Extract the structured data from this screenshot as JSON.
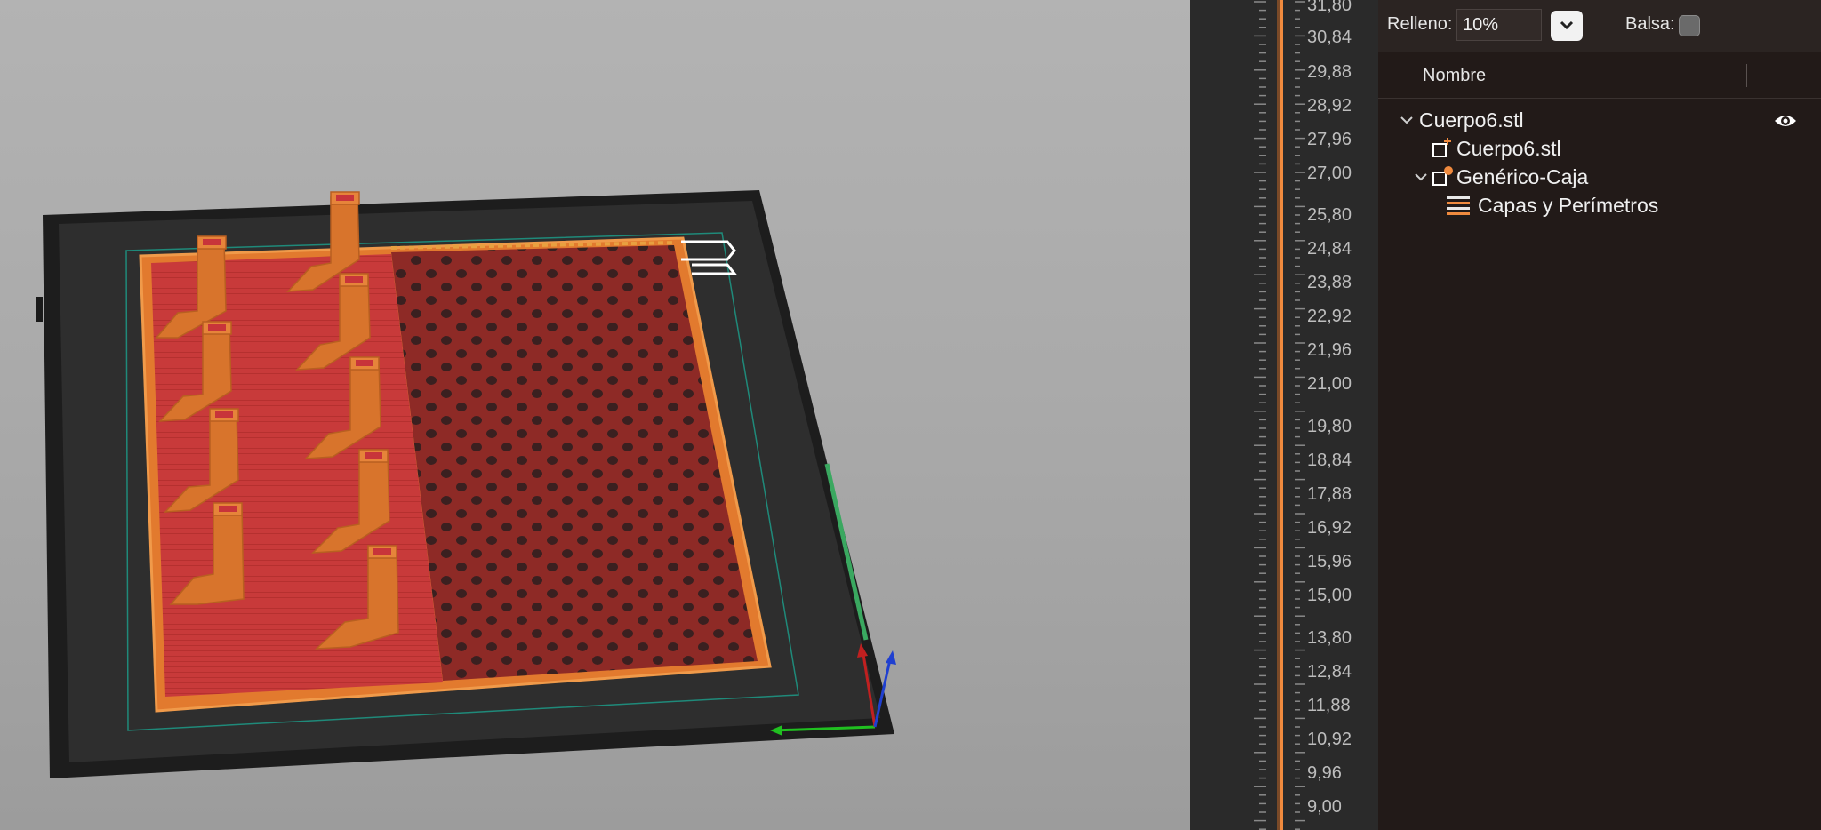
{
  "layer_ruler": {
    "labels": [
      "31,80",
      "30,84",
      "29,88",
      "28,92",
      "27,96",
      "27,00",
      "25,80",
      "24,84",
      "23,88",
      "22,92",
      "21,96",
      "21,00",
      "19,80",
      "18,84",
      "17,88",
      "16,92",
      "15,96",
      "15,00",
      "13,80",
      "12,84",
      "11,88",
      "10,92",
      "9,96",
      "9,00"
    ]
  },
  "settings": {
    "infill_label": "Relleno:",
    "infill_value": "10%",
    "raft_label": "Balsa:"
  },
  "object_list": {
    "column_header": "Nombre",
    "root_name": "Cuerpo6.stl",
    "children": [
      {
        "name": "Cuerpo6.stl"
      },
      {
        "name": "Genérico-Caja"
      },
      {
        "name": "Capas y Perímetros"
      }
    ]
  },
  "colors": {
    "accent": "#f08a3e",
    "part_orange": "#e27a2e",
    "infill_red": "#c8343a",
    "sidebar_bg": "#221a18",
    "bed": "#2d2d2d"
  }
}
